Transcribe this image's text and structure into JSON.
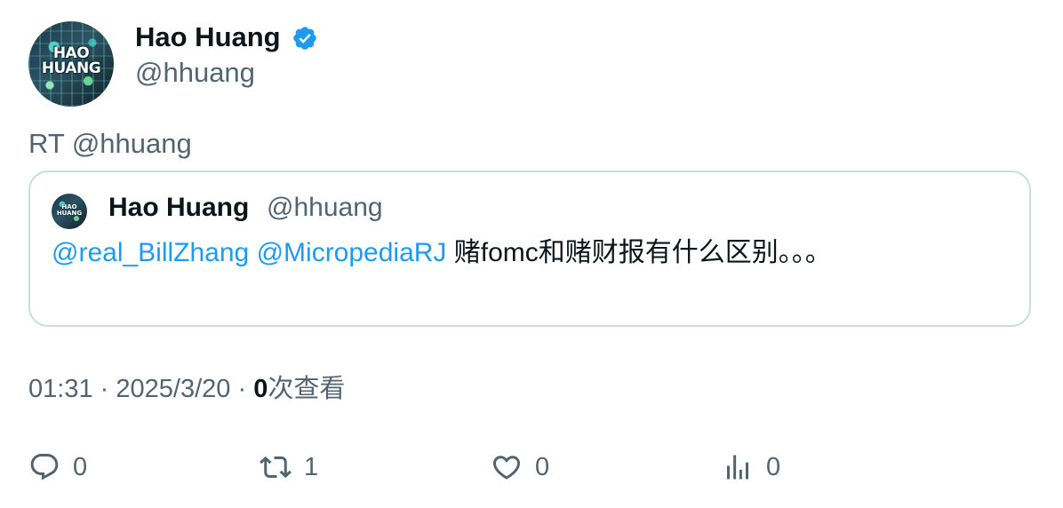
{
  "author": {
    "display_name": "Hao Huang",
    "handle": "@hhuang",
    "verified": true,
    "avatar_text_line1": "HAO",
    "avatar_text_line2": "HUANG"
  },
  "tweet": {
    "text": "RT @hhuang"
  },
  "quoted": {
    "display_name": "Hao Huang",
    "handle": "@hhuang",
    "mention1": "@real_BillZhang",
    "mention2": "@MicropediaRJ",
    "body": "赌fomc和赌财报有什么区别。。。"
  },
  "meta": {
    "time": "01:31",
    "separator": "·",
    "date": "2025/3/20",
    "views_count": "0",
    "views_label": "次查看"
  },
  "actions": {
    "reply_count": "0",
    "retweet_count": "1",
    "like_count": "0",
    "views_count": "0"
  },
  "colors": {
    "accent": "#1d9bf0",
    "secondary_text": "#536471",
    "border": "#cfd9de"
  }
}
